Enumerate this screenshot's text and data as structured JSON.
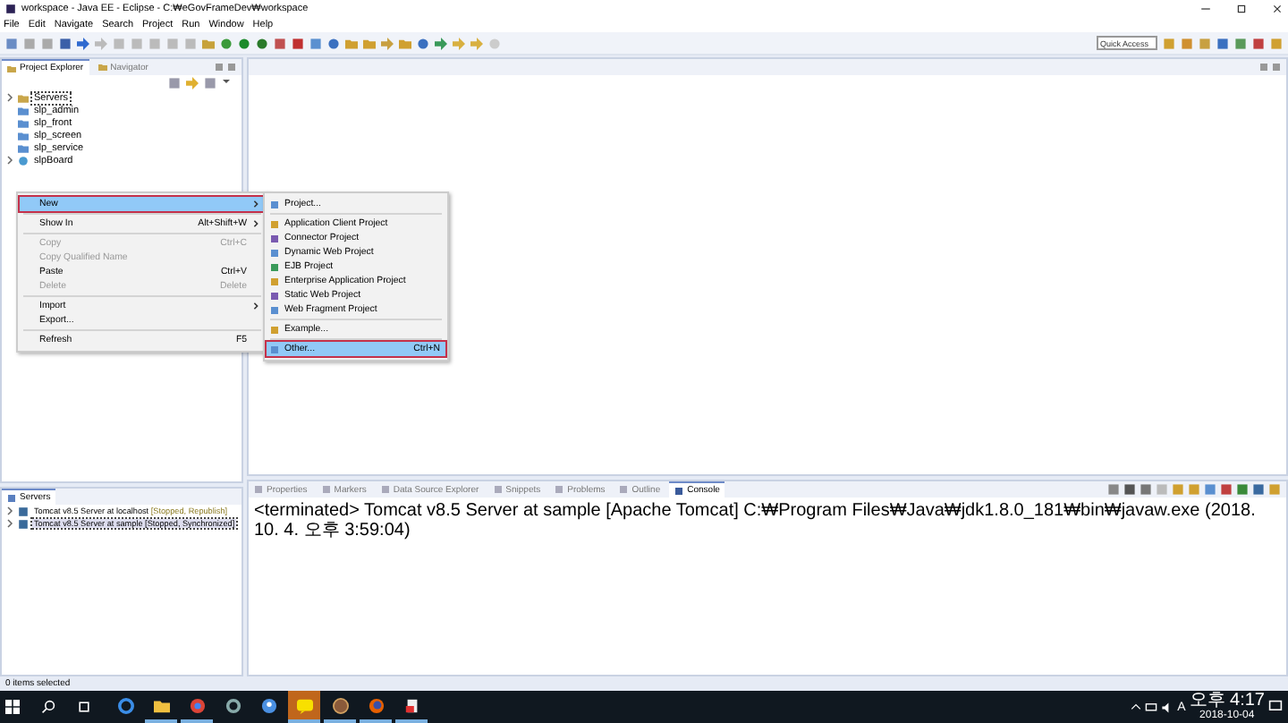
{
  "window": {
    "title": "workspace - Java EE - Eclipse - C:₩eGovFrameDev₩workspace"
  },
  "menu": [
    "File",
    "Edit",
    "Navigate",
    "Search",
    "Project",
    "Run",
    "Window",
    "Help"
  ],
  "quick_access": {
    "placeholder": "Quick Access"
  },
  "explorer": {
    "tabs": [
      {
        "label": "Project Explorer",
        "selected": true
      },
      {
        "label": "Navigator",
        "selected": false
      }
    ],
    "tree": [
      {
        "label": "Servers",
        "kind": "servers",
        "expandable": true,
        "selected": true
      },
      {
        "label": "slp_admin",
        "kind": "project",
        "expandable": false,
        "selected": false
      },
      {
        "label": "slp_front",
        "kind": "project",
        "expandable": false,
        "selected": false
      },
      {
        "label": "slp_screen",
        "kind": "project",
        "expandable": false,
        "selected": false
      },
      {
        "label": "slp_service",
        "kind": "project",
        "expandable": false,
        "selected": false
      },
      {
        "label": "slpBoard",
        "kind": "web",
        "expandable": true,
        "selected": false
      }
    ]
  },
  "context_menu": [
    {
      "kind": "item",
      "label": "New",
      "submenu": true,
      "disabled": false,
      "selected": true
    },
    {
      "kind": "separator"
    },
    {
      "kind": "item",
      "label": "Show In",
      "shortcut": "Alt+Shift+W",
      "submenu": true,
      "disabled": false,
      "selected": false
    },
    {
      "kind": "separator"
    },
    {
      "kind": "item",
      "label": "Copy",
      "shortcut": "Ctrl+C",
      "submenu": false,
      "disabled": true,
      "selected": false
    },
    {
      "kind": "item",
      "label": "Copy Qualified Name",
      "submenu": false,
      "disabled": true,
      "selected": false
    },
    {
      "kind": "item",
      "label": "Paste",
      "shortcut": "Ctrl+V",
      "submenu": false,
      "disabled": false,
      "selected": false
    },
    {
      "kind": "item",
      "label": "Delete",
      "shortcut": "Delete",
      "submenu": false,
      "disabled": true,
      "selected": false
    },
    {
      "kind": "separator"
    },
    {
      "kind": "item",
      "label": "Import",
      "submenu": true,
      "disabled": false,
      "selected": false
    },
    {
      "kind": "item",
      "label": "Export...",
      "submenu": false,
      "disabled": false,
      "selected": false
    },
    {
      "kind": "separator"
    },
    {
      "kind": "item",
      "label": "Refresh",
      "shortcut": "F5",
      "submenu": false,
      "disabled": false,
      "selected": false
    }
  ],
  "submenu": [
    {
      "kind": "item",
      "label": "Project...",
      "selected": false
    },
    {
      "kind": "separator"
    },
    {
      "kind": "item",
      "label": "Application Client Project",
      "selected": false
    },
    {
      "kind": "item",
      "label": "Connector Project",
      "selected": false
    },
    {
      "kind": "item",
      "label": "Dynamic Web Project",
      "selected": false
    },
    {
      "kind": "item",
      "label": "EJB Project",
      "selected": false
    },
    {
      "kind": "item",
      "label": "Enterprise Application Project",
      "selected": false
    },
    {
      "kind": "item",
      "label": "Static Web Project",
      "selected": false
    },
    {
      "kind": "item",
      "label": "Web Fragment Project",
      "selected": false
    },
    {
      "kind": "separator"
    },
    {
      "kind": "item",
      "label": "Example...",
      "selected": false
    },
    {
      "kind": "separator"
    },
    {
      "kind": "item",
      "label": "Other...",
      "shortcut": "Ctrl+N",
      "selected": true
    }
  ],
  "servers": {
    "title": "Servers",
    "items": [
      {
        "name": "Tomcat v8.5 Server at localhost",
        "status": "[Stopped, Republish]",
        "selected": false
      },
      {
        "name": "Tomcat v8.5 Server at sample",
        "status": "[Stopped, Synchronized]",
        "selected": true
      }
    ]
  },
  "bottom_tabs": [
    {
      "label": "Properties",
      "selected": false
    },
    {
      "label": "Markers",
      "selected": false
    },
    {
      "label": "Data Source Explorer",
      "selected": false
    },
    {
      "label": "Snippets",
      "selected": false
    },
    {
      "label": "Problems",
      "selected": false
    },
    {
      "label": "Outline",
      "selected": false
    },
    {
      "label": "Console",
      "selected": true
    }
  ],
  "console": {
    "line": "<terminated> Tomcat v8.5 Server at sample [Apache Tomcat] C:₩Program Files₩Java₩jdk1.8.0_181₩bin₩javaw.exe (2018. 10. 4. 오후 3:59:04)"
  },
  "status_bar": "0 items selected",
  "taskbar": {
    "apps": [
      {
        "kind": "browser",
        "running": false,
        "active": false
      },
      {
        "kind": "folder",
        "running": true,
        "active": false
      },
      {
        "kind": "globe",
        "running": true,
        "active": false
      },
      {
        "kind": "ring",
        "running": false,
        "active": false
      },
      {
        "kind": "person",
        "running": false,
        "active": false
      },
      {
        "kind": "chat",
        "running": true,
        "active": true
      },
      {
        "kind": "game",
        "running": true,
        "active": false
      },
      {
        "kind": "fox",
        "running": true,
        "active": false
      },
      {
        "kind": "document",
        "running": true,
        "active": false
      }
    ],
    "ime": "A",
    "time": "오후 4:17",
    "date": "2018-10-04"
  }
}
